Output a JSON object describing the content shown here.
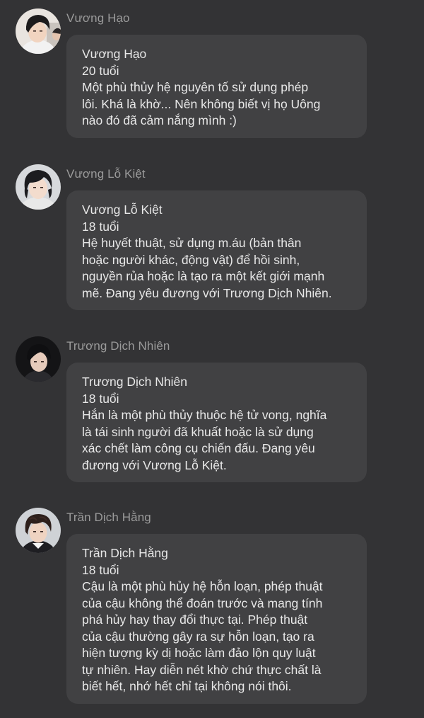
{
  "messages": [
    {
      "sender": "Vương Hạo",
      "avatar_icon": "avatar-vuong-hao-icon",
      "lines": [
        "Vương Hạo",
        "20 tuổi",
        "Một phù thủy hệ nguyên tố sử dụng phép",
        "lôi. Khá là khờ... Nên không biết vị họ Uông",
        "nào đó đã cảm nắng mình :)"
      ]
    },
    {
      "sender": "Vương Lỗ Kiệt",
      "avatar_icon": "avatar-vuong-lo-kiet-icon",
      "lines": [
        "Vương Lỗ Kiệt",
        "18 tuổi",
        "Hệ huyết thuật, sử dụng m.áu (bản thân",
        "hoặc người khác, động vật) để hồi sinh,",
        "nguyền rủa hoặc là tạo ra một kết giới mạnh",
        "mẽ. Đang yêu đương với Trương Dịch Nhiên."
      ]
    },
    {
      "sender": "Trương Dịch Nhiên",
      "avatar_icon": "avatar-truong-dich-nhien-icon",
      "lines": [
        "Trương Dịch Nhiên",
        "18 tuổi",
        "Hắn là một phù thủy thuộc hệ tử vong, nghĩa",
        "là tái sinh người đã khuất hoặc là sử dụng",
        "xác chết làm công cụ chiến đấu. Đang yêu",
        "đương với Vương Lỗ Kiệt."
      ]
    },
    {
      "sender": "Trần Dịch Hằng",
      "avatar_icon": "avatar-tran-dich-hang-icon",
      "lines": [
        "Trần Dịch Hằng",
        "18 tuổi",
        "Cậu là một phù hủy hệ hỗn loạn, phép thuật",
        "của cậu không thể đoán trước và mang tính",
        "phá hủy hay thay đổi thực tại. Phép thuật",
        "của cậu thường gây ra sự hỗn loạn, tạo ra",
        "hiện tượng kỳ dị hoặc làm đảo lộn quy luật",
        "tự nhiên. Hay diễn nét khờ chứ thực chất là",
        "biết hết, nhớ hết chỉ tại không nói thôi."
      ]
    }
  ],
  "colors": {
    "background": "#333335",
    "bubble": "#414143",
    "sender": "#9b9b9b",
    "text": "#e8e8e8"
  }
}
